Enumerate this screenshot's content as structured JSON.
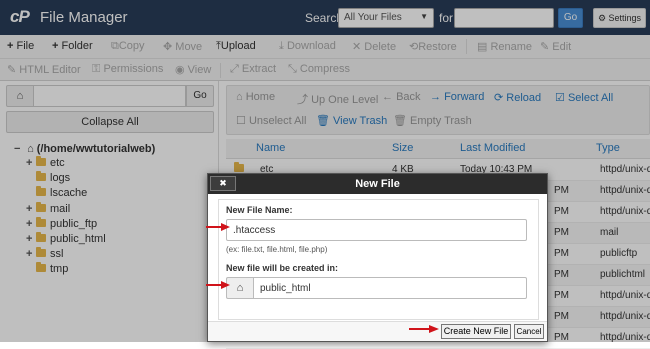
{
  "header": {
    "logo": "cP",
    "title": "File Manager",
    "search_label": "Search",
    "search_scope": "All Your Files",
    "for_label": "for",
    "search_value": "",
    "go_label": "Go",
    "settings_label": "Settings"
  },
  "toolbar1": [
    {
      "icon": "plus-icon",
      "glyph": "+",
      "label": "File",
      "enabled": true
    },
    {
      "icon": "plus-icon",
      "glyph": "+",
      "label": "Folder",
      "enabled": true
    },
    {
      "icon": "copy-icon",
      "glyph": "⧉",
      "label": "Copy",
      "enabled": false
    },
    {
      "icon": "move-icon",
      "glyph": "✥",
      "label": "Move",
      "enabled": false
    },
    {
      "icon": "upload-icon",
      "glyph": "⤒",
      "label": "Upload",
      "enabled": true
    },
    {
      "icon": "download-icon",
      "glyph": "⤓",
      "label": "Download",
      "enabled": false
    },
    {
      "icon": "delete-icon",
      "glyph": "✕",
      "label": "Delete",
      "enabled": false
    },
    {
      "icon": "restore-icon",
      "glyph": "⟲",
      "label": "Restore",
      "enabled": false
    },
    {
      "icon": "rename-icon",
      "glyph": "▤",
      "label": "Rename",
      "enabled": false
    },
    {
      "icon": "edit-icon",
      "glyph": "✎",
      "label": "Edit",
      "enabled": false
    }
  ],
  "toolbar2": [
    {
      "icon": "html-editor-icon",
      "glyph": "✎",
      "label": "HTML Editor",
      "enabled": false
    },
    {
      "icon": "key-icon",
      "glyph": "⚿",
      "label": "Permissions",
      "enabled": false
    },
    {
      "icon": "eye-icon",
      "glyph": "◉",
      "label": "View",
      "enabled": false
    },
    {
      "icon": "extract-icon",
      "glyph": "⤢",
      "label": "Extract",
      "enabled": false
    },
    {
      "icon": "compress-icon",
      "glyph": "⤡",
      "label": "Compress",
      "enabled": false
    }
  ],
  "left": {
    "home_glyph": "⌂",
    "path_value": "",
    "go_label": "Go",
    "collapse_label": "Collapse All",
    "root_label": "(/home/wwtutorialweb)",
    "tree": [
      {
        "label": "etc",
        "expandable": true
      },
      {
        "label": "logs",
        "expandable": false
      },
      {
        "label": "lscache",
        "expandable": false
      },
      {
        "label": "mail",
        "expandable": true
      },
      {
        "label": "public_ftp",
        "expandable": true
      },
      {
        "label": "public_html",
        "expandable": true
      },
      {
        "label": "ssl",
        "expandable": true
      },
      {
        "label": "tmp",
        "expandable": false
      }
    ]
  },
  "nav": {
    "home": "Home",
    "up": "Up One Level",
    "back": "Back",
    "forward": "Forward",
    "reload": "Reload",
    "select_all": "Select All",
    "unselect_all": "Unselect All",
    "view_trash": "View Trash",
    "empty_trash": "Empty Trash"
  },
  "table": {
    "headers": {
      "name": "Name",
      "size": "Size",
      "modified": "Last Modified",
      "type": "Type"
    },
    "rows": [
      {
        "name": "etc",
        "size": "4 KB",
        "modified": "Today 10:43 PM",
        "type": "httpd/unix-d"
      },
      {
        "name": "",
        "size": "",
        "modified": "PM",
        "type": "httpd/unix-d"
      },
      {
        "name": "",
        "size": "",
        "modified": "PM",
        "type": "httpd/unix-d"
      },
      {
        "name": "",
        "size": "",
        "modified": "PM",
        "type": "mail"
      },
      {
        "name": "",
        "size": "",
        "modified": "PM",
        "type": "publicftp"
      },
      {
        "name": "",
        "size": "",
        "modified": "PM",
        "type": "publichtml"
      },
      {
        "name": "",
        "size": "",
        "modified": "PM",
        "type": "httpd/unix-d"
      },
      {
        "name": "",
        "size": "",
        "modified": "PM",
        "type": "httpd/unix-d"
      },
      {
        "name": "",
        "size": "",
        "modified": "PM",
        "type": "httpd/unix-d"
      },
      {
        "name": "",
        "size": "",
        "modified": "PM",
        "type": "httpd/unix-d"
      }
    ]
  },
  "modal": {
    "close_glyph": "✖",
    "title": "New File",
    "name_label": "New File Name:",
    "name_value": ".htaccess",
    "name_hint": "(ex: file.txt, file.html, file.php)",
    "location_label": "New file will be created in:",
    "location_value": "public_html",
    "create_label": "Create New File",
    "cancel_label": "Cancel"
  },
  "colors": {
    "header_bg": "#283c58",
    "link": "#2a7bc0",
    "arrow": "#d0131a"
  }
}
